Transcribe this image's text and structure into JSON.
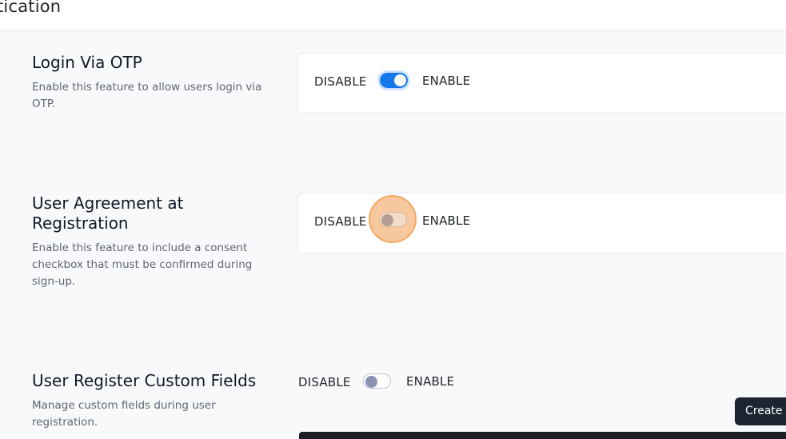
{
  "header": {
    "title": "tication"
  },
  "settings": {
    "otp": {
      "title": "Login Via OTP",
      "description": "Enable this feature to allow users login via OTP.",
      "disable_label": "DISABLE",
      "enable_label": "ENABLE",
      "enabled": true
    },
    "agreement": {
      "title": "User Agreement at Registration",
      "description": "Enable this feature to include a consent checkbox that must be confirmed during sign-up.",
      "disable_label": "DISABLE",
      "enable_label": "ENABLE",
      "enabled": false
    },
    "custom_fields": {
      "title": "User Register Custom Fields",
      "description": "Manage custom fields during user registration.",
      "disable_label": "DISABLE",
      "enable_label": "ENABLE",
      "enabled": false,
      "create_label": "Create"
    }
  },
  "colors": {
    "accent": "#1478e8",
    "focus_ring": "#f7c79e",
    "dark_button": "#1c2430"
  }
}
